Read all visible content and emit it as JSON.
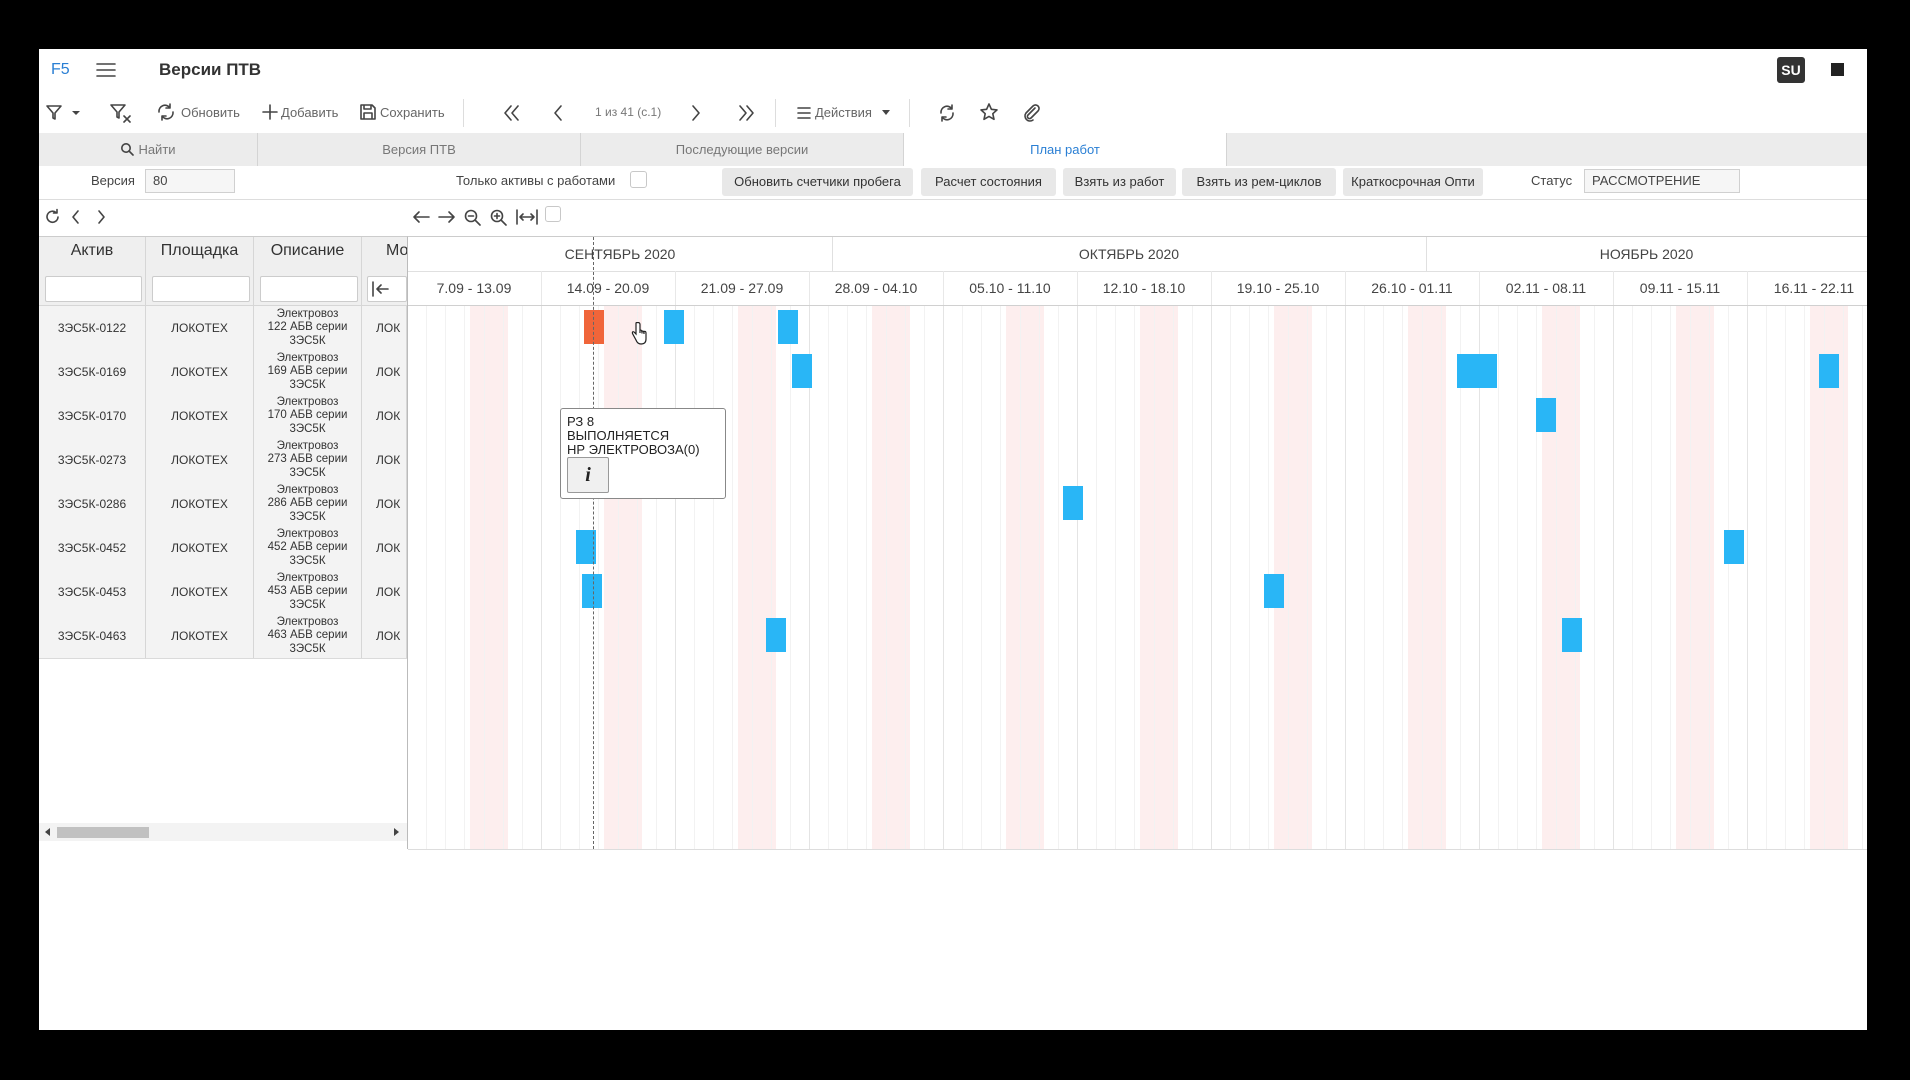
{
  "app": {
    "logo": "F5",
    "title": "Версии ПТВ",
    "badge": "SU"
  },
  "toolbar": {
    "refresh": "Обновить",
    "add": "Добавить",
    "save": "Сохранить",
    "pager": "1 из 41 (с.1)",
    "actions": "Действия"
  },
  "tabs": [
    {
      "label": "Найти",
      "icon": "search-icon"
    },
    {
      "label": "Версия ПТВ"
    },
    {
      "label": "Последующие версии"
    },
    {
      "label": "План работ",
      "active": true
    }
  ],
  "form": {
    "version_label": "Версия",
    "version_value": "80",
    "only_assets_label": "Только активы с работами",
    "status_label": "Статус",
    "status_value": "РАССМОТРЕНИЕ",
    "buttons": [
      "Обновить счетчики пробега",
      "Расчет состояния",
      "Взять из работ",
      "Взять из рем-циклов",
      "Краткосрочная Опти"
    ]
  },
  "table": {
    "headers": [
      "Актив",
      "Площадка",
      "Описание",
      "Мо"
    ],
    "rows": [
      {
        "asset": "3ЭС5К-0122",
        "site": "ЛОКОТЕХ",
        "desc": "Электровоз\n122 АБВ серии\n3ЭС5К",
        "model": "ЛОК"
      },
      {
        "asset": "3ЭС5К-0169",
        "site": "ЛОКОТЕХ",
        "desc": "Электровоз\n169 АБВ серии\n3ЭС5К",
        "model": "ЛОК"
      },
      {
        "asset": "3ЭС5К-0170",
        "site": "ЛОКОТЕХ",
        "desc": "Электровоз\n170 АБВ серии\n3ЭС5К",
        "model": "ЛОК"
      },
      {
        "asset": "3ЭС5К-0273",
        "site": "ЛОКОТЕХ",
        "desc": "Электровоз\n273 АБВ серии\n3ЭС5К",
        "model": "ЛОК"
      },
      {
        "asset": "3ЭС5К-0286",
        "site": "ЛОКОТЕХ",
        "desc": "Электровоз\n286 АБВ серии\n3ЭС5К",
        "model": "ЛОК"
      },
      {
        "asset": "3ЭС5К-0452",
        "site": "ЛОКОТЕХ",
        "desc": "Электровоз\n452 АБВ серии\n3ЭС5К",
        "model": "ЛОК"
      },
      {
        "asset": "3ЭС5К-0453",
        "site": "ЛОКОТЕХ",
        "desc": "Электровоз\n453 АБВ серии\n3ЭС5К",
        "model": "ЛОК"
      },
      {
        "asset": "3ЭС5К-0463",
        "site": "ЛОКОТЕХ",
        "desc": "Электровоз\n463 АБВ серии\n3ЭС5К",
        "model": "ЛОК"
      }
    ]
  },
  "gantt": {
    "months": [
      "СЕНТЯБРЬ 2020",
      "ОКТЯБРЬ 2020",
      "НОЯБРЬ 2020"
    ],
    "weeks": [
      "7.09 - 13.09",
      "14.09 - 20.09",
      "21.09 - 27.09",
      "28.09 - 04.10",
      "05.10 - 11.10",
      "12.10 - 18.10",
      "19.10 - 25.10",
      "26.10 - 01.11",
      "02.11 - 08.11",
      "09.11 - 15.11",
      "16.11 - 22.11"
    ],
    "bar_color": "#29b6f6",
    "active_color": "#f0653a",
    "tooltip": {
      "line1": "РЗ 8",
      "line2": "ВЫПОЛНЯЕТСЯ",
      "line3": "НР ЭЛЕКТРОВОЗА(0)",
      "info": "i"
    }
  }
}
